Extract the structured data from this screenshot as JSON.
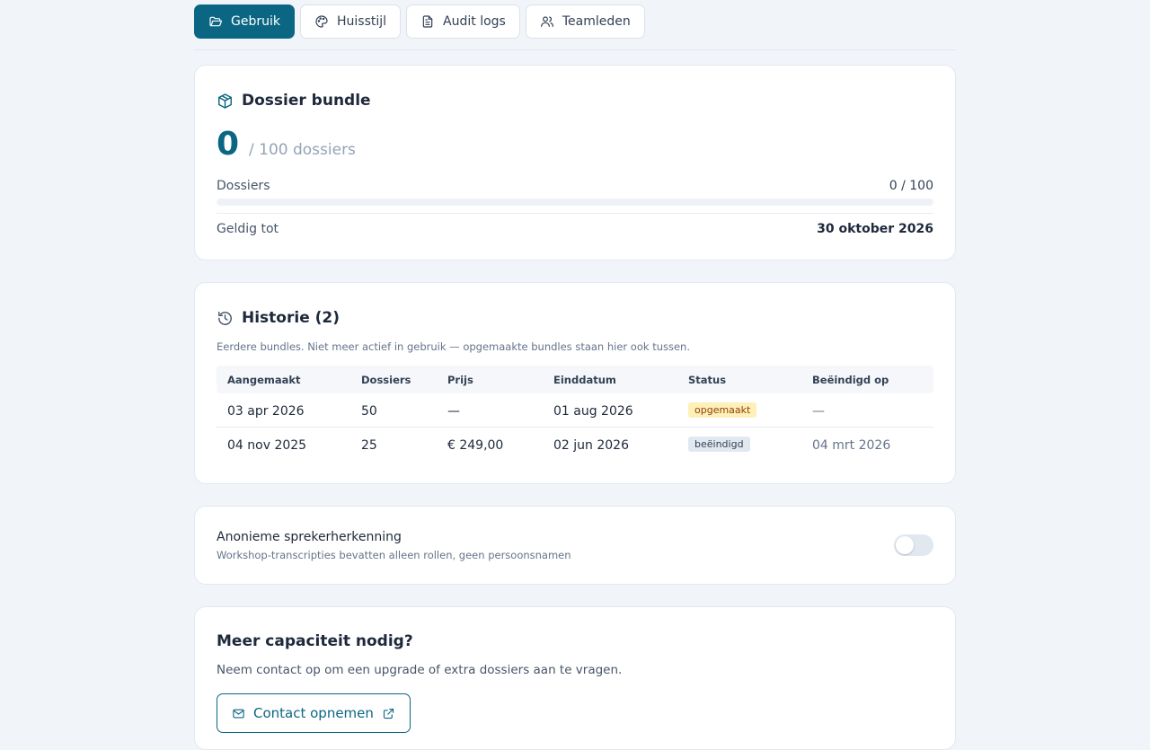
{
  "tabs": [
    {
      "label": "Gebruik",
      "icon": "folder-open-icon",
      "active": true
    },
    {
      "label": "Huisstijl",
      "icon": "palette-icon",
      "active": false
    },
    {
      "label": "Audit logs",
      "icon": "file-text-icon",
      "active": false
    },
    {
      "label": "Teamleden",
      "icon": "users-icon",
      "active": false
    }
  ],
  "bundle": {
    "title": "Dossier bundle",
    "used": "0",
    "total_label": "/ 100 dossiers",
    "dossiers_label": "Dossiers",
    "dossiers_value": "0 / 100",
    "progress_fraction": 0,
    "valid_label": "Geldig tot",
    "valid_value": "30 oktober 2026"
  },
  "history": {
    "title": "Historie (2)",
    "description": "Eerdere bundles. Niet meer actief in gebruik — opgemaakte bundles staan hier ook tussen.",
    "columns": [
      "Aangemaakt",
      "Dossiers",
      "Prijs",
      "Einddatum",
      "Status",
      "Beëindigd op"
    ],
    "rows": [
      {
        "created": "03 apr 2026",
        "dossiers": "50",
        "price": "—",
        "end": "01 aug 2026",
        "status": "opgemaakt",
        "ended_on": "—"
      },
      {
        "created": "04 nov 2025",
        "dossiers": "25",
        "price": "€ 249,00",
        "end": "02 jun 2026",
        "status": "beëindigd",
        "ended_on": "04 mrt 2026"
      }
    ]
  },
  "anon": {
    "title": "Anonieme sprekerherkenning",
    "description": "Workshop-transcripties bevatten alleen rollen, geen persoonsnamen",
    "enabled": false
  },
  "capacity": {
    "title": "Meer capaciteit nodig?",
    "description": "Neem contact op om een upgrade of extra dossiers aan te vragen.",
    "button_label": "Contact opnemen"
  },
  "colors": {
    "accent": "#0b6684",
    "background": "#f1f5f9",
    "badge_used_bg": "#fdf0b8",
    "badge_ended_bg": "#e2e8f0"
  }
}
